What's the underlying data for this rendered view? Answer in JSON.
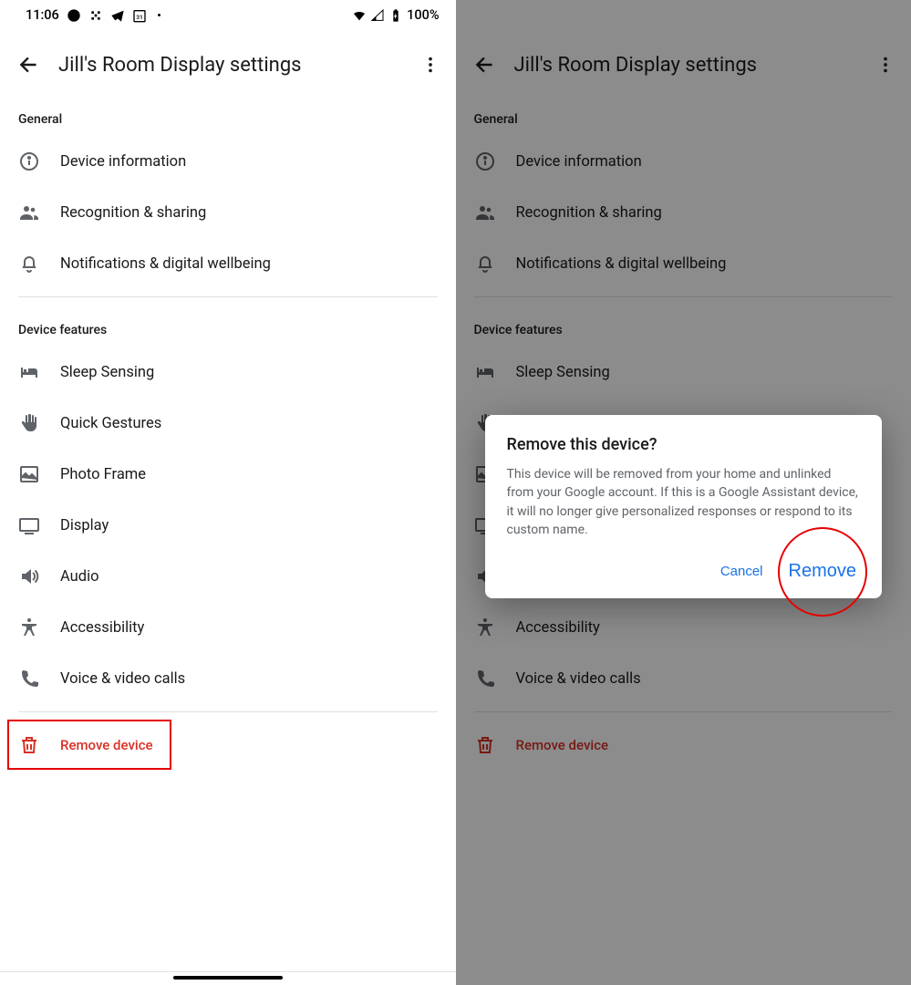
{
  "status": {
    "time": "11:06",
    "battery_text": "100%"
  },
  "header": {
    "title": "Jill's Room Display settings"
  },
  "sections": {
    "general": {
      "label": "General",
      "items": [
        {
          "label": "Device information"
        },
        {
          "label": "Recognition & sharing"
        },
        {
          "label": "Notifications & digital wellbeing"
        }
      ]
    },
    "features": {
      "label": "Device features",
      "items": [
        {
          "label": "Sleep Sensing"
        },
        {
          "label": "Quick Gestures"
        },
        {
          "label": "Photo Frame"
        },
        {
          "label": "Display"
        },
        {
          "label": "Audio"
        },
        {
          "label": "Accessibility"
        },
        {
          "label": "Voice & video calls"
        }
      ]
    },
    "remove": {
      "label": "Remove device"
    }
  },
  "dialog": {
    "title": "Remove this device?",
    "body": "This device will be removed from your home and unlinked from your Google account. If this is a Google Assistant device, it will no longer give personalized responses or respond to its custom name.",
    "cancel": "Cancel",
    "confirm": "Remove"
  }
}
